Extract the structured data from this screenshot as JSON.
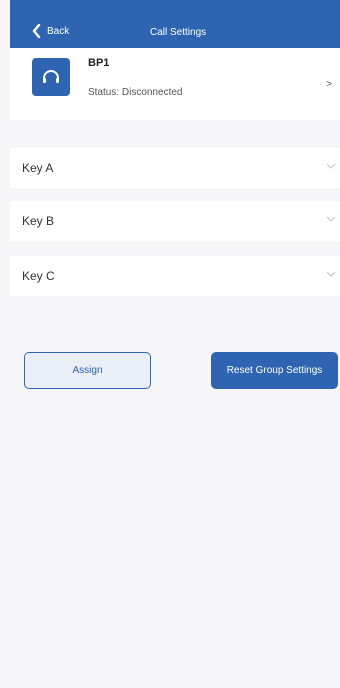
{
  "header": {
    "back_label": "Back",
    "title": "Call Settings"
  },
  "device": {
    "icon": "headset-icon",
    "name": "BP1",
    "status": "Status: Disconnected",
    "chevron": ">"
  },
  "keys": [
    {
      "label": "Key A"
    },
    {
      "label": "Key B"
    },
    {
      "label": "Key C"
    }
  ],
  "buttons": {
    "assign_label": "Assign",
    "reset_label": "Reset Group Settings"
  },
  "colors": {
    "accent": "#2f64b3",
    "background": "#f7f7f9",
    "surface": "#ffffff"
  }
}
